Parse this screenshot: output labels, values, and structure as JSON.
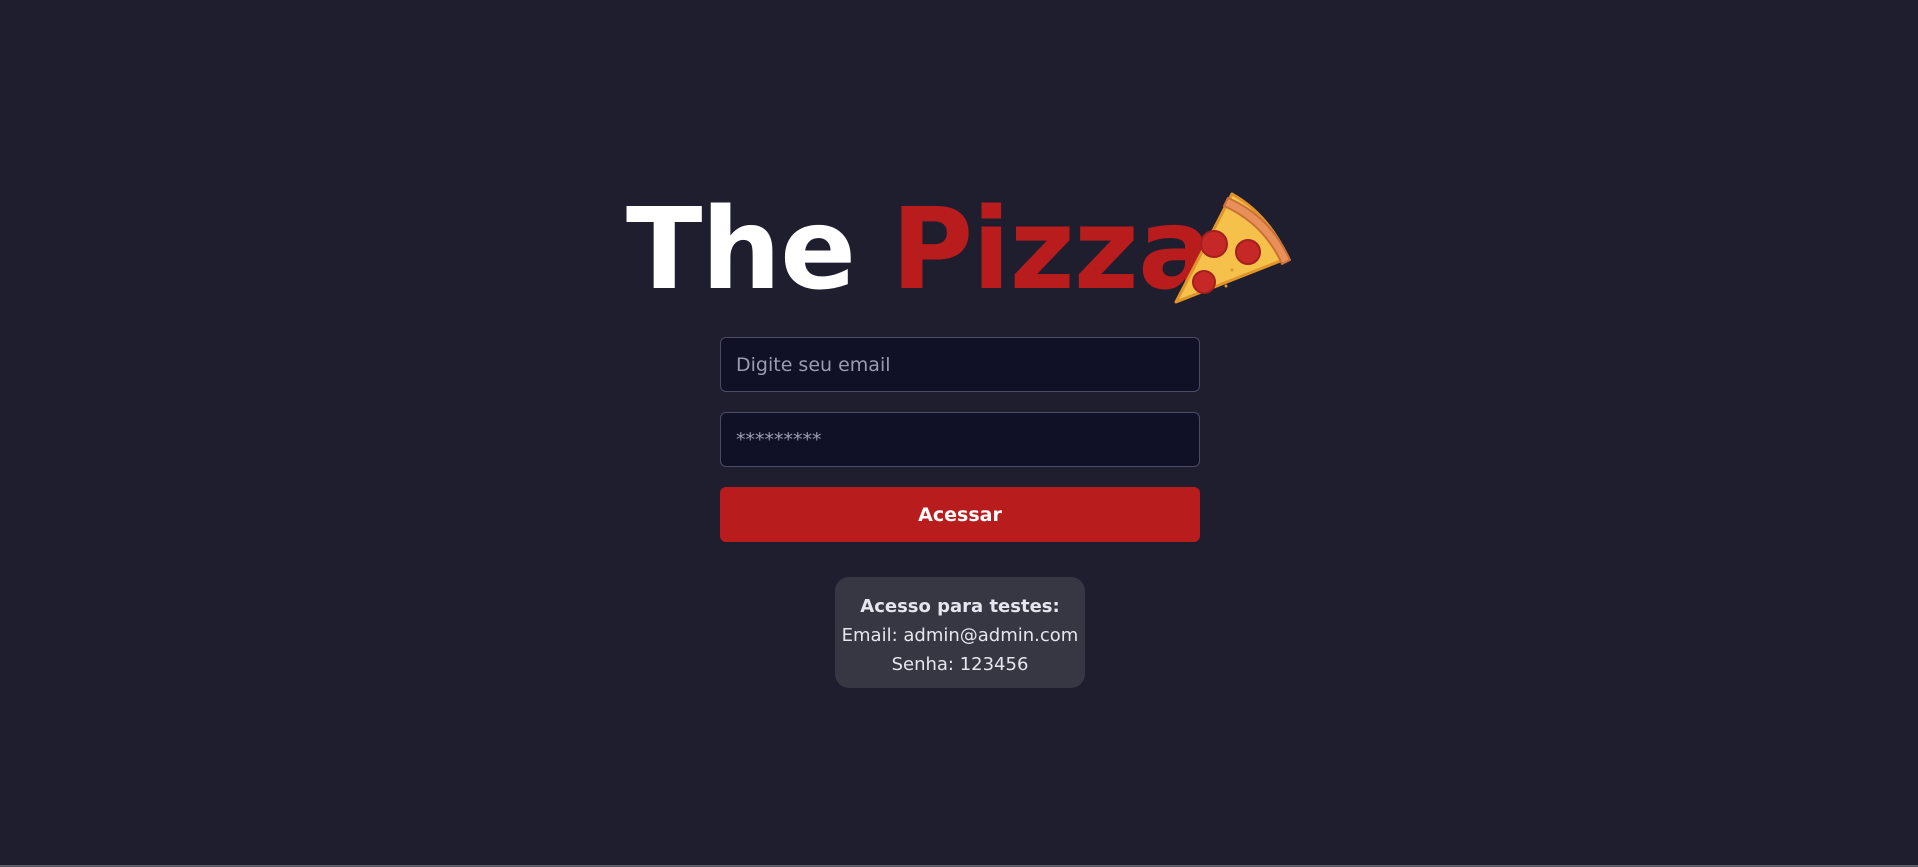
{
  "logo": {
    "word1": "The",
    "word2": "Pizza",
    "icon": "pizza-slice-icon"
  },
  "login_form": {
    "email_placeholder": "Digite seu email",
    "password_placeholder": "*********",
    "submit_label": "Acessar"
  },
  "test_access": {
    "title": "Acesso para testes:",
    "email_line": "Email: admin@admin.com",
    "password_line": "Senha: 123456"
  },
  "colors": {
    "background": "#1e1e2f",
    "accent": "#b91c1c",
    "input_background": "#101026",
    "info_background": "#373744"
  }
}
